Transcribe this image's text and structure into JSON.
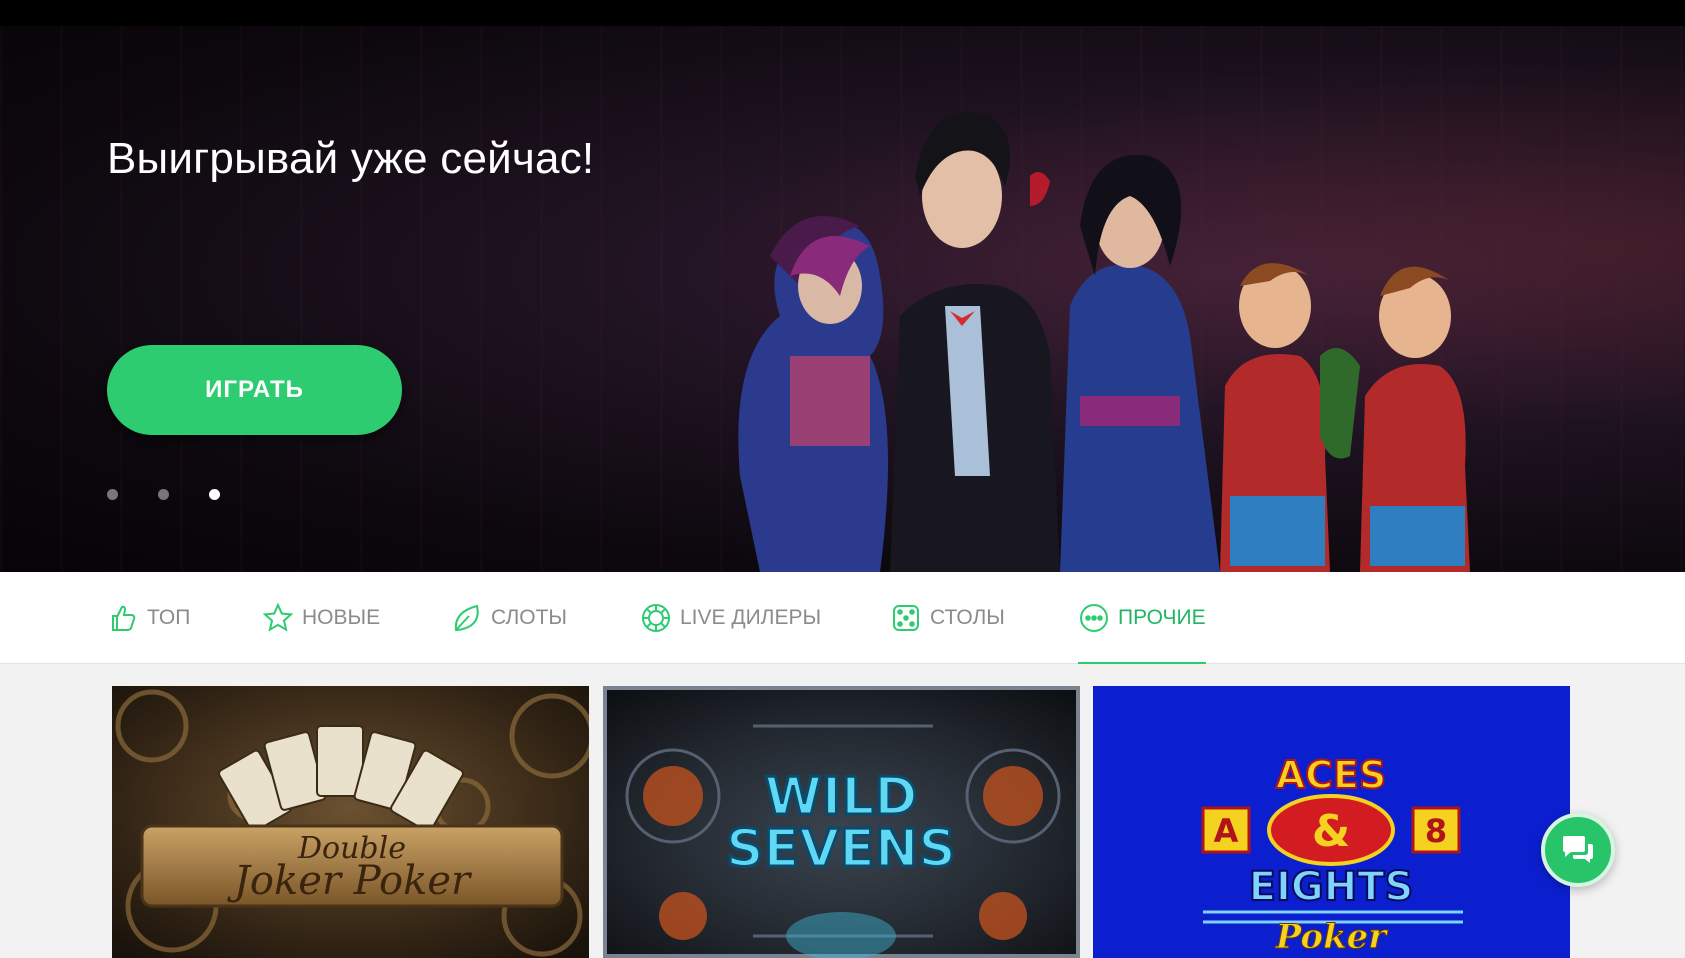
{
  "hero": {
    "title": "Выигрывай уже сейчас!",
    "play_button": "ИГРАТЬ",
    "slides": 3,
    "active_slide": 3
  },
  "tabs": [
    {
      "label": "ТОП",
      "icon": "thumbs-up-icon",
      "active": false
    },
    {
      "label": "НОВЫЕ",
      "icon": "star-icon",
      "active": false
    },
    {
      "label": "СЛОТЫ",
      "icon": "leaf-icon",
      "active": false
    },
    {
      "label": "LIVE ДИЛЕРЫ",
      "icon": "chip-icon",
      "active": false
    },
    {
      "label": "СТОЛЫ",
      "icon": "dice-icon",
      "active": false
    },
    {
      "label": "ПРОЧИЕ",
      "icon": "more-icon",
      "active": true
    }
  ],
  "games": [
    {
      "logo_line1": "Double",
      "logo_line2": "Joker Poker"
    },
    {
      "logo_line1": "WILD",
      "logo_line2": "SEVENS"
    },
    {
      "logo_top": "ACES",
      "logo_left": "A",
      "logo_mid": "&",
      "logo_right": "8",
      "logo_line1": "EIGHTS",
      "logo_line2": "Poker"
    }
  ],
  "colors": {
    "accent": "#2ecc71",
    "active_tab": "#22b566",
    "inactive_tab": "#8b8b8b"
  },
  "chat": {
    "icon": "chat-bubbles-icon"
  }
}
